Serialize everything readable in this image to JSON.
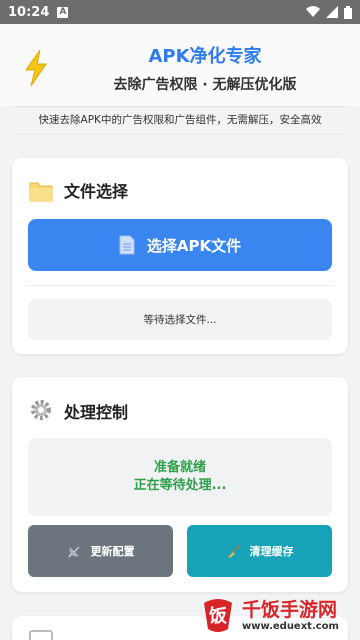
{
  "status_bar": {
    "time": "10:24",
    "notif_letter": "A"
  },
  "header": {
    "title": "APK净化专家",
    "subtitle": "去除广告权限 · 无解压优化版",
    "description": "快速去除APK中的广告权限和广告组件，无需解压，安全高效",
    "icon": "lightning-bolt-icon",
    "accent_color": "#2f7bf0"
  },
  "file_section": {
    "title": "文件选择",
    "icon": "folder-icon",
    "select_button": "选择APK文件",
    "status_text": "等待选择文件..."
  },
  "control_section": {
    "title": "处理控制",
    "icon": "gear-icon",
    "state_line1": "准备就绪",
    "state_line2": "正在等待处理...",
    "update_button": "更新配置",
    "clean_button": "清理缓存"
  },
  "watermark": {
    "name": "千饭手游网",
    "url": "www.eduext.com"
  },
  "colors": {
    "primary": "#3a86f0",
    "secondary": "#6c757d",
    "info": "#17a2b8",
    "success": "#2ea04a"
  }
}
